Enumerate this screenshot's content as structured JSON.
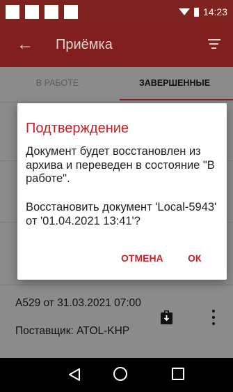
{
  "status_bar": {
    "time": "14:23"
  },
  "app_bar": {
    "title": "Приёмка",
    "back_icon": "arrow-back-icon",
    "filter_icon": "filter-clear-icon"
  },
  "tabs": [
    {
      "label": "В РАБОТЕ",
      "selected": false
    },
    {
      "label": "ЗАВЕРШЕННЫЕ",
      "selected": true
    }
  ],
  "list_item": {
    "title": "А529 от 31.03.2021 07:00",
    "supplier": "Поставщик: ATOL-KHP",
    "status_icon": "clipboard-download-icon",
    "menu_icon": "more-vert-icon"
  },
  "dialog": {
    "title": "Подтверждение",
    "message_1": "Документ будет восстановлен из архива и переведен в состояние \"В работе\".",
    "message_2": "Восстановить документ 'Local-5943' от '01.04.2021 13:41'?",
    "cancel_label": "ОТМЕНА",
    "ok_label": "ОК"
  },
  "colors": {
    "accent": "#cc1e22",
    "app_bar": "#801f1d",
    "status_bar": "#7e2320"
  }
}
